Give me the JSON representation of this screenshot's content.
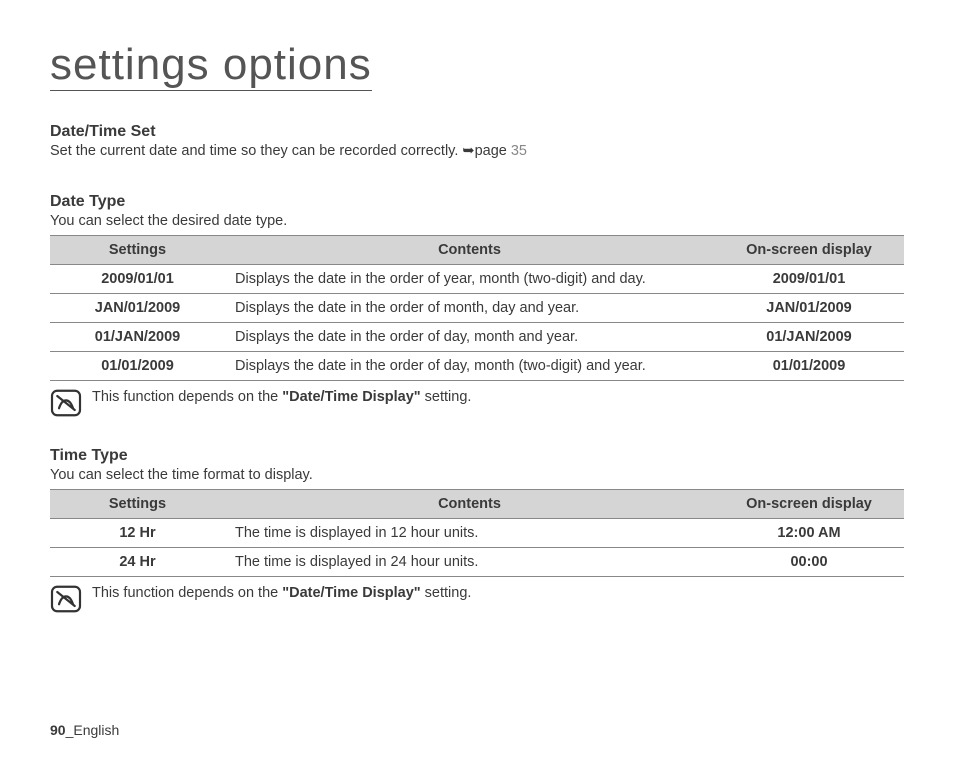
{
  "title": "settings options",
  "dateTimeSet": {
    "heading": "Date/Time Set",
    "desc_prefix": "Set the current date and time so they can be recorded correctly. ",
    "desc_page_label": "page ",
    "desc_page_num": "35"
  },
  "dateType": {
    "heading": "Date Type",
    "desc": "You can select the desired date type.",
    "headers": {
      "settings": "Settings",
      "contents": "Contents",
      "display": "On-screen display"
    },
    "rows": [
      {
        "setting": "2009/01/01",
        "content": "Displays the date in the order of year, month (two-digit) and day.",
        "display": "2009/01/01"
      },
      {
        "setting": "JAN/01/2009",
        "content": "Displays the date in the order of month, day and year.",
        "display": "JAN/01/2009"
      },
      {
        "setting": "01/JAN/2009",
        "content": "Displays the date in the order of day, month and year.",
        "display": "01/JAN/2009"
      },
      {
        "setting": "01/01/2009",
        "content": "Displays the date in the order of day, month (two-digit) and year.",
        "display": "01/01/2009"
      }
    ],
    "note_prefix": "This function depends on the ",
    "note_bold": "\"Date/Time Display\"",
    "note_suffix": " setting."
  },
  "timeType": {
    "heading": "Time Type",
    "desc": "You can select the time format to display.",
    "headers": {
      "settings": "Settings",
      "contents": "Contents",
      "display": "On-screen display"
    },
    "rows": [
      {
        "setting": "12 Hr",
        "content": "The time is displayed in 12 hour units.",
        "display": "12:00 AM"
      },
      {
        "setting": "24 Hr",
        "content": "The time is displayed in 24 hour units.",
        "display": "00:00"
      }
    ],
    "note_prefix": "This function depends on the ",
    "note_bold": "\"Date/Time Display\"",
    "note_suffix": " setting."
  },
  "footer": {
    "page_number": "90",
    "sep": "_",
    "lang": "English"
  }
}
